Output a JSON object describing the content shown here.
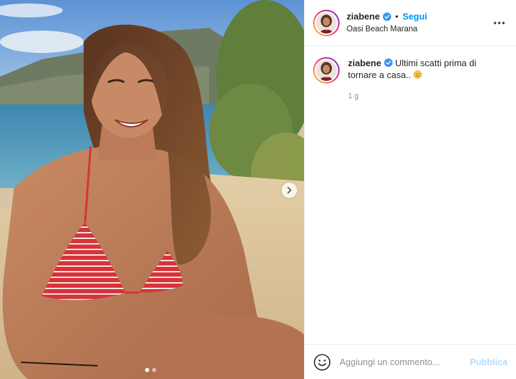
{
  "post": {
    "username": "ziabene",
    "separator": "•",
    "follow_label": "Segui",
    "location": "Oasi Beach Marana",
    "more_icon": "more-horizontal-icon"
  },
  "caption": {
    "username": "ziabene",
    "text": "Ultimi scatti prima di tornare a casa..",
    "emoji": "sad-face-emoji",
    "time": "1 g"
  },
  "carousel": {
    "total_slides": 2,
    "active_slide": 1,
    "next_icon": "chevron-right-icon"
  },
  "comment_box": {
    "placeholder": "Aggiungi un commento...",
    "publish_label": "Pubblica",
    "emoji_icon": "smiley-icon"
  },
  "colors": {
    "accent": "#0095f6",
    "publish_disabled": "#b3dbff",
    "verified": "#3897f0",
    "muted": "#8e8e8e"
  }
}
